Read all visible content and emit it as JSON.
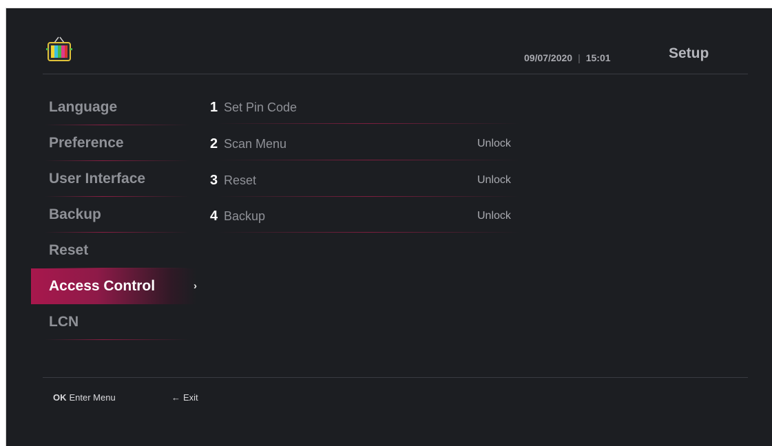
{
  "header": {
    "date": "09/07/2020",
    "separator": "|",
    "time": "15:01",
    "title": "Setup",
    "logo_icon": "retro-tv-icon"
  },
  "sidebar": {
    "items": [
      {
        "label": "Language"
      },
      {
        "label": "Preference"
      },
      {
        "label": "User Interface"
      },
      {
        "label": "Backup"
      },
      {
        "label": "Reset"
      },
      {
        "label": "Access Control",
        "active": true
      },
      {
        "label": "LCN"
      }
    ],
    "chevron": "›"
  },
  "options": [
    {
      "number": "1",
      "label": "Set Pin Code",
      "status": ""
    },
    {
      "number": "2",
      "label": "Scan Menu",
      "status": "Unlock"
    },
    {
      "number": "3",
      "label": "Reset",
      "status": "Unlock"
    },
    {
      "number": "4",
      "label": "Backup",
      "status": "Unlock"
    }
  ],
  "footer": {
    "ok_key": "OK",
    "ok_label": "Enter Menu",
    "back_key": "←",
    "back_label": "Exit"
  },
  "colors": {
    "background": "#1c1e22",
    "accent": "#a8184d",
    "text_muted": "#8f9197"
  }
}
